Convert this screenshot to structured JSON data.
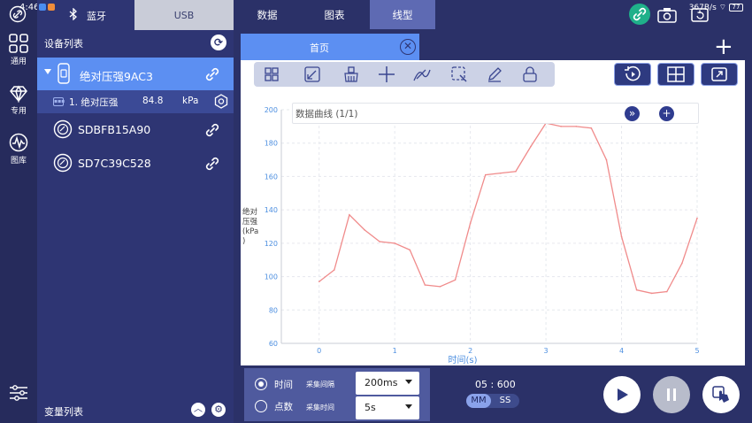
{
  "status_bar": {
    "time": "4:46",
    "right_text": "367B/s",
    "battery": "77"
  },
  "rail": {
    "items": [
      {
        "label": "通用",
        "icon": "grid-icon"
      },
      {
        "label": "专用",
        "icon": "diamond-icon"
      },
      {
        "label": "图库",
        "icon": "waveform-icon"
      }
    ]
  },
  "device_panel": {
    "tabs": [
      {
        "label": "蓝牙",
        "icon": "bluetooth-icon"
      },
      {
        "label": "USB"
      }
    ],
    "header": "设备列表",
    "devices": [
      {
        "name": "绝对压强9AC3",
        "expanded": true
      },
      {
        "name": "SDBFB15A90"
      },
      {
        "name": "SD7C39C528"
      }
    ],
    "sub_item": {
      "index_name": "1. 绝对压强",
      "value": "84.8",
      "unit": "kPa"
    },
    "variable_list_label": "变量列表"
  },
  "top_tabs": [
    {
      "label": "数据"
    },
    {
      "label": "图表"
    },
    {
      "label": "线型",
      "active": true
    }
  ],
  "content": {
    "home_tab": "首页",
    "chart_title": "数据曲线 (1/1)"
  },
  "bottom": {
    "time_radio": "时间",
    "count_radio": "点数",
    "interval_label": "采集间隔",
    "duration_label": "采集时间",
    "interval_value": "200ms",
    "duration_value": "5s",
    "timer": "05 : 600",
    "mm": "MM",
    "ss": "SS"
  },
  "colors": {
    "accent": "#5c8ff2",
    "line": "#f08b8b",
    "panel": "#2e3573",
    "green": "#1fb08a"
  },
  "chart_data": {
    "type": "line",
    "xlabel": "时间(s)",
    "ylabel": "绝对压强(kPa)",
    "xlim": [
      -0.5,
      5
    ],
    "ylim": [
      60,
      200
    ],
    "xticks": [
      0,
      1,
      2,
      3,
      4,
      5
    ],
    "yticks": [
      60,
      80,
      100,
      120,
      140,
      160,
      180,
      200
    ],
    "grid": true,
    "x": [
      0,
      0.2,
      0.4,
      0.6,
      0.8,
      1.0,
      1.2,
      1.4,
      1.6,
      1.8,
      2.0,
      2.2,
      2.4,
      2.6,
      2.8,
      3.0,
      3.2,
      3.4,
      3.6,
      3.8,
      4.0,
      4.2,
      4.4,
      4.6,
      4.8,
      5.0
    ],
    "values": [
      97,
      104,
      137,
      128,
      121,
      120,
      116,
      95,
      94,
      98,
      132,
      161,
      162,
      163,
      178,
      192,
      190,
      190,
      189,
      170,
      124,
      92,
      90,
      91,
      108,
      135
    ]
  }
}
